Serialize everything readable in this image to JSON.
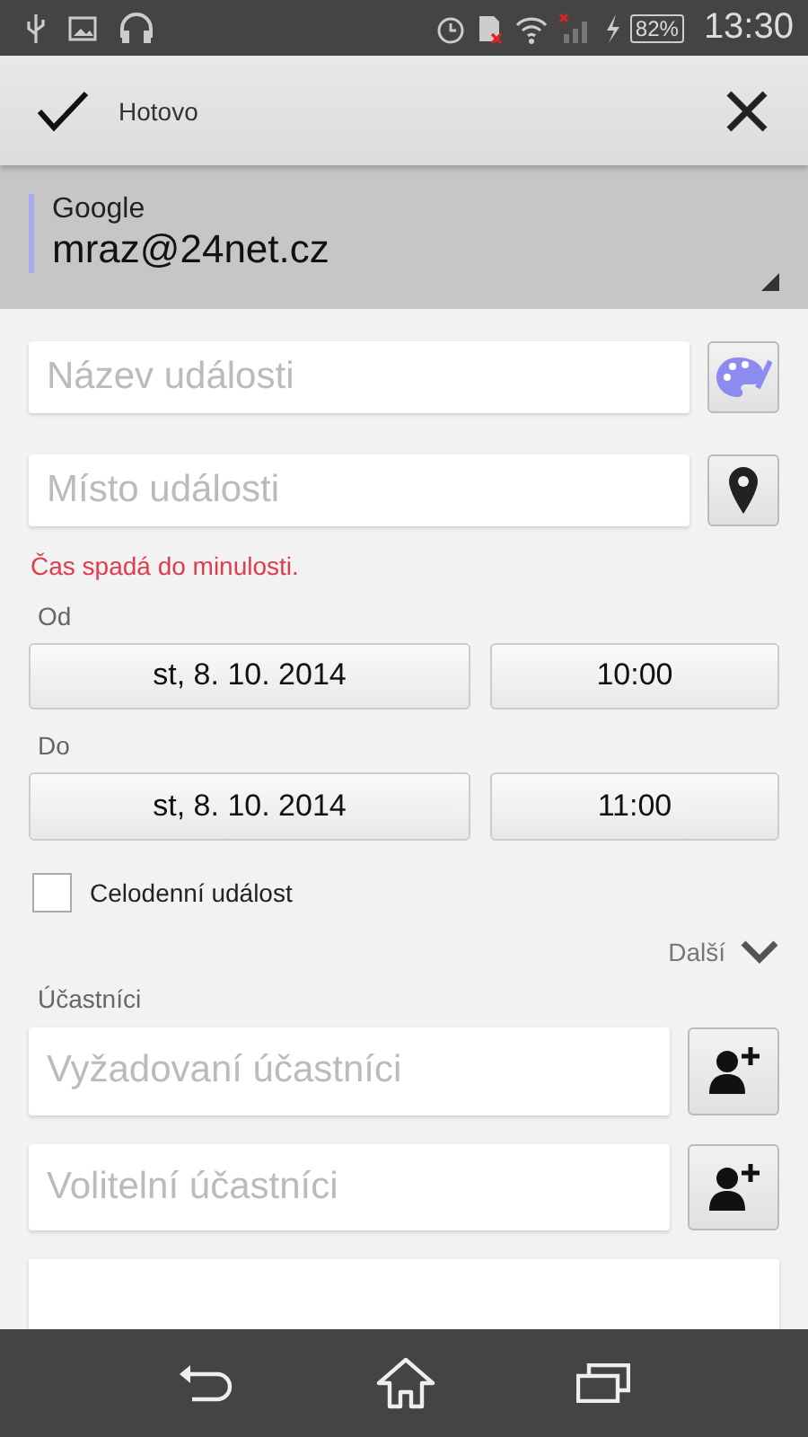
{
  "status_bar": {
    "battery": "82%",
    "time": "13:30"
  },
  "action_bar": {
    "done_label": "Hotovo"
  },
  "account": {
    "provider": "Google",
    "email": "mraz@24net.cz"
  },
  "fields": [
    {
      "placeholder": "Název události",
      "kind": "color"
    },
    {
      "placeholder": "Místo události",
      "kind": "location"
    }
  ],
  "error": "Čas spadá do minulosti.",
  "times": [
    {
      "label": "Od",
      "date": "st, 8. 10. 2014",
      "time": "10:00"
    },
    {
      "label": "Do",
      "date": "st, 8. 10. 2014",
      "time": "11:00"
    }
  ],
  "all_day": {
    "label": "Celodenní událost",
    "checked": false
  },
  "more": "Další",
  "guests": {
    "label": "Účastníci",
    "fields": [
      {
        "placeholder": "Vyžadovaní účastníci"
      },
      {
        "placeholder": "Volitelní účastníci"
      }
    ]
  }
}
